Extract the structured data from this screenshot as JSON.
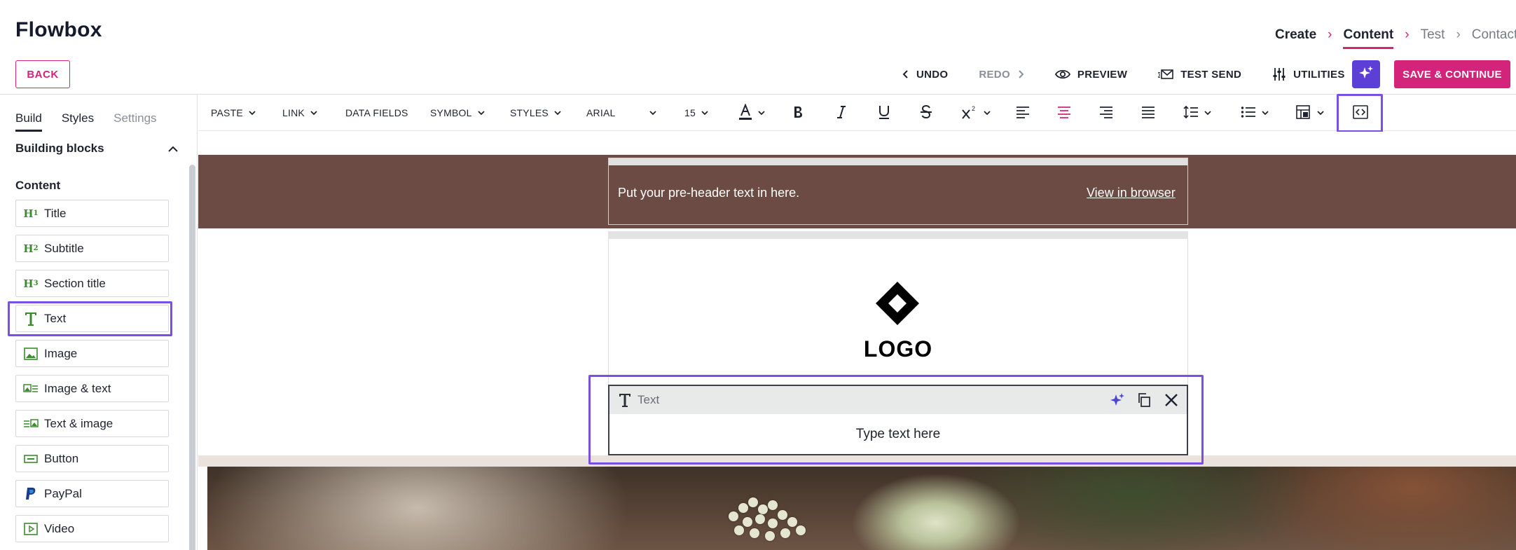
{
  "app": {
    "title": "Flowbox"
  },
  "steps": [
    {
      "label": "Create",
      "state": "done"
    },
    {
      "label": "Content",
      "state": "active"
    },
    {
      "label": "Test",
      "state": "todo"
    },
    {
      "label": "Contact",
      "state": "todo"
    }
  ],
  "header": {
    "back_label": "BACK",
    "undo_label": "UNDO",
    "redo_label": "REDO",
    "preview_label": "PREVIEW",
    "test_send_label": "TEST SEND",
    "utilities_label": "UTILITIES",
    "save_label": "SAVE & CONTINUE"
  },
  "left_panel": {
    "tabs": [
      {
        "label": "Build",
        "active": true
      },
      {
        "label": "Styles",
        "active": false
      },
      {
        "label": "Settings",
        "active": false
      }
    ],
    "section_title": "Building blocks",
    "group_label": "Content",
    "blocks": [
      {
        "label": "Title",
        "icon": "h1-icon"
      },
      {
        "label": "Subtitle",
        "icon": "h2-icon"
      },
      {
        "label": "Section title",
        "icon": "h3-icon"
      },
      {
        "label": "Text",
        "icon": "text-t-icon"
      },
      {
        "label": "Image",
        "icon": "image-icon"
      },
      {
        "label": "Image & text",
        "icon": "image-text-icon"
      },
      {
        "label": "Text & image",
        "icon": "text-image-icon"
      },
      {
        "label": "Button",
        "icon": "button-icon"
      },
      {
        "label": "PayPal",
        "icon": "paypal-icon"
      },
      {
        "label": "Video",
        "icon": "video-icon"
      }
    ]
  },
  "toolbar": {
    "paste": "PASTE",
    "link": "LINK",
    "data_fields": "DATA FIELDS",
    "symbol": "SYMBOL",
    "styles": "STYLES",
    "font": "ARIAL",
    "font_size": "15"
  },
  "canvas": {
    "preheader_text": "Put your pre-header text in here.",
    "view_in_browser": "View in browser",
    "logo_text": "LOGO",
    "text_block_label": "Text",
    "text_block_placeholder": "Type text here"
  },
  "colors": {
    "brand_pink": "#d4237a",
    "highlight_purple": "#7b4fe4",
    "ai_button": "#5b3fd6",
    "preheader_bg": "#6b4b43",
    "block_icon_green": "#3c8a2e"
  }
}
